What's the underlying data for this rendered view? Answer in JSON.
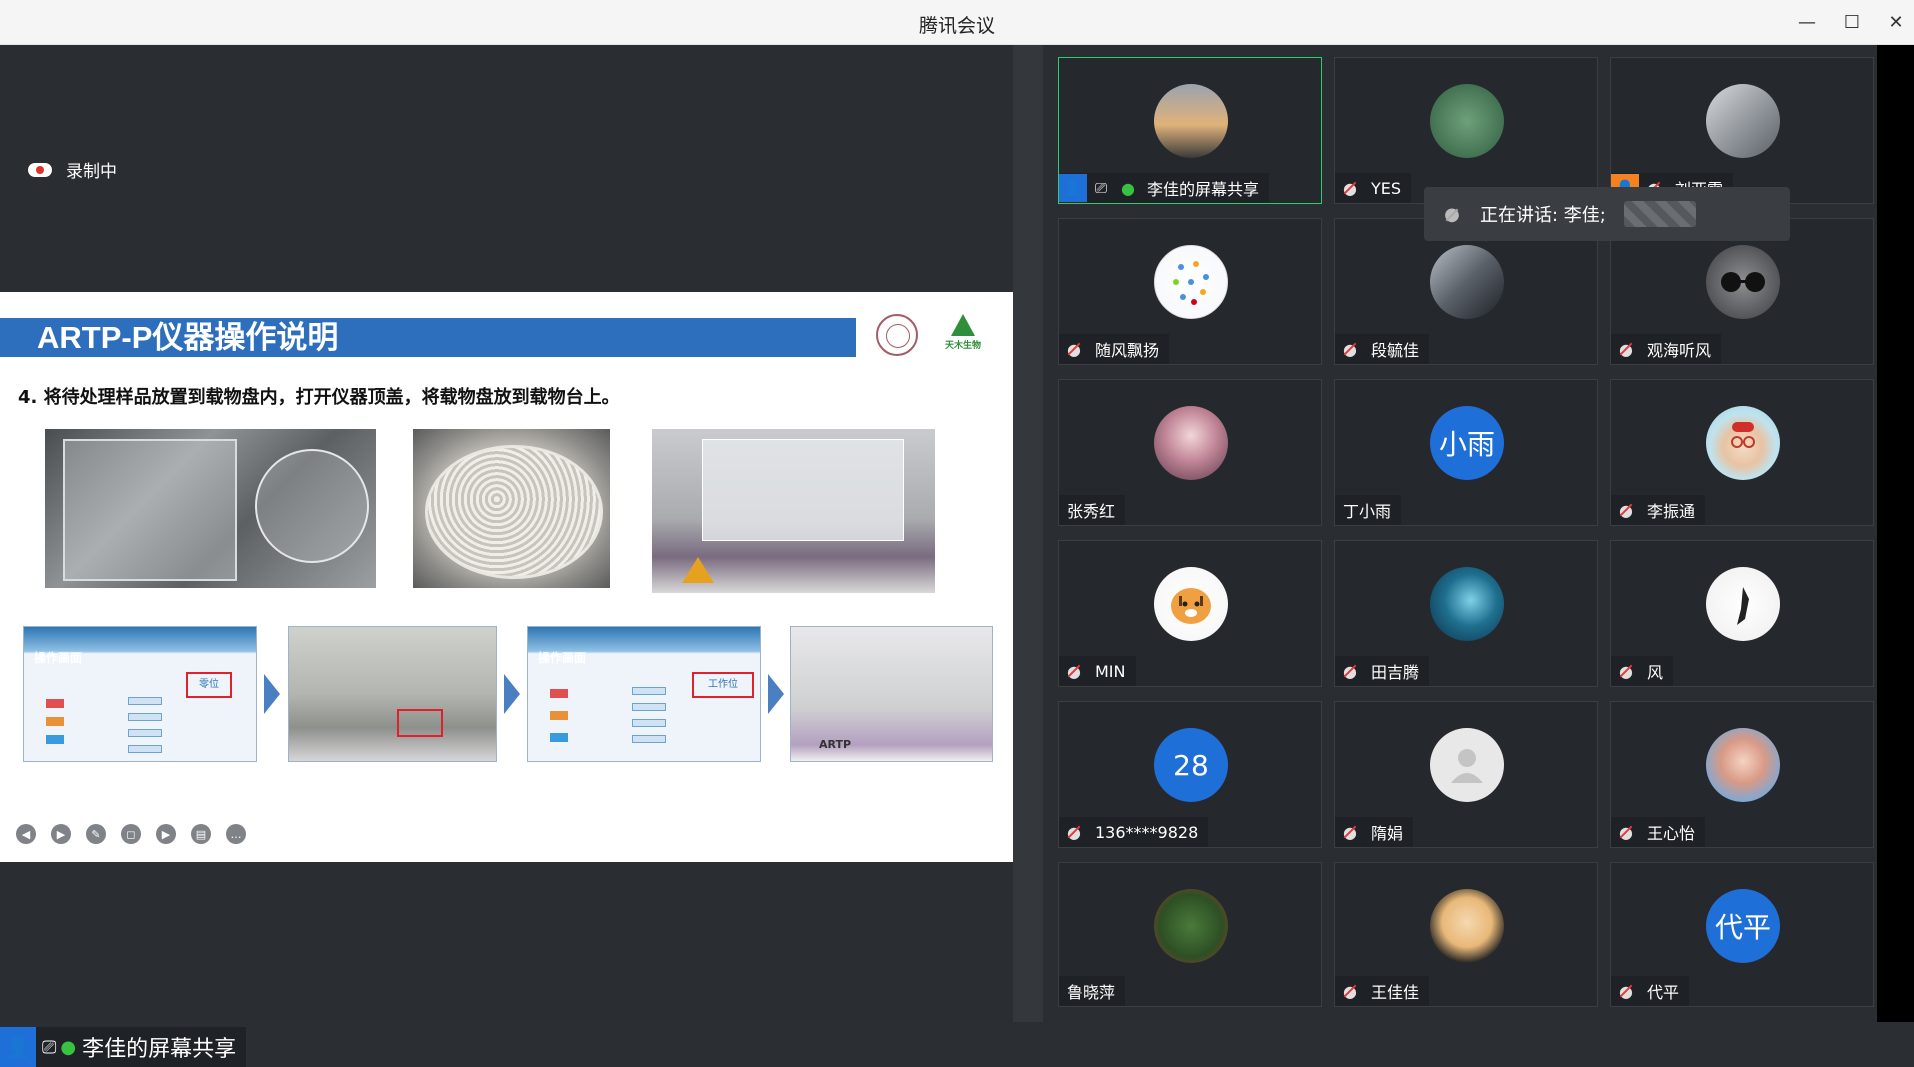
{
  "window": {
    "title": "腾讯会议",
    "minimize": "—",
    "maximize": "☐",
    "close": "✕"
  },
  "share": {
    "recording_label": "录制中",
    "sharer_label": "李佳的屏幕共享",
    "slide": {
      "title": "ARTP-P仪器操作说明",
      "logo_text": "天木生物",
      "step": "4. 将待处理样品放置到载物盘内，打开仪器顶盖，将载物盘放到载物台上。",
      "screen_header": "操作画面",
      "screen_button_1": "零位",
      "screen_button_3": "工作位",
      "device_label": "ARTP"
    }
  },
  "speaking": {
    "text": "正在讲话: 李佳;"
  },
  "participants": [
    {
      "name": "李佳的屏幕共享",
      "muted": false,
      "avatar": "sunset-photo"
    },
    {
      "name": "YES",
      "muted": true,
      "avatar": "forest-photo"
    },
    {
      "name": "刘亚雷",
      "muted": true,
      "avatar": "machine-photo"
    },
    {
      "name": "随风飘扬",
      "muted": true,
      "avatar": "dots-graphic"
    },
    {
      "name": "段毓佳",
      "muted": true,
      "avatar": "silhouette-photo"
    },
    {
      "name": "观海听风",
      "muted": true,
      "avatar": "cat-sunglasses"
    },
    {
      "name": "张秀红",
      "muted": false,
      "avatar": "anime-girl"
    },
    {
      "name": "丁小雨",
      "muted": false,
      "avatar_text": "小雨"
    },
    {
      "name": "李振通",
      "muted": true,
      "avatar": "cartoon-man"
    },
    {
      "name": "MIN",
      "muted": true,
      "avatar": "tiger-cartoon"
    },
    {
      "name": "田吉腾",
      "muted": true,
      "avatar": "ocean-photo"
    },
    {
      "name": "风",
      "muted": true,
      "avatar": "ink-painting"
    },
    {
      "name": "136****9828",
      "muted": true,
      "avatar_text": "28"
    },
    {
      "name": "隋娟",
      "muted": true,
      "avatar": "default-person"
    },
    {
      "name": "王心怡",
      "muted": true,
      "avatar": "girl-photo"
    },
    {
      "name": "鲁晓萍",
      "muted": false,
      "avatar": "plant-photo"
    },
    {
      "name": "王佳佳",
      "muted": true,
      "avatar": "luffy-cartoon"
    },
    {
      "name": "代平",
      "muted": true,
      "avatar_text": "代平"
    }
  ],
  "colors": {
    "accent_blue": "#1f6fd8",
    "active_border": "#2ecc71",
    "mic_green": "#37c341",
    "mute_red": "#e43a3a",
    "banner_blue": "#2d6fbd"
  }
}
